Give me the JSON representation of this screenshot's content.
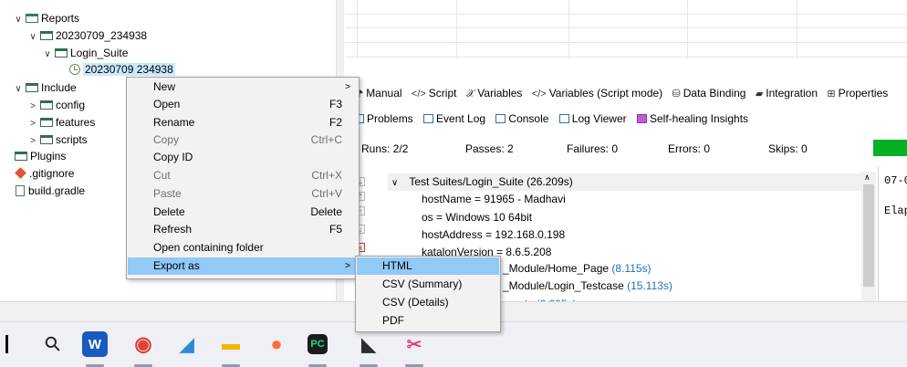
{
  "explorer": {
    "items": [
      {
        "label": "Reports",
        "toggle": "∨"
      },
      {
        "label": "20230709_234938",
        "toggle": "∨"
      },
      {
        "label": "Login_Suite",
        "toggle": "∨"
      },
      {
        "label": "20230709 234938",
        "toggle": ""
      },
      {
        "label": "Include",
        "toggle": "∨"
      },
      {
        "label": "config",
        "toggle": ">"
      },
      {
        "label": "features",
        "toggle": ">"
      },
      {
        "label": "scripts",
        "toggle": ">"
      },
      {
        "label": "Plugins",
        "toggle": ""
      },
      {
        "label": ".gitignore",
        "toggle": ""
      },
      {
        "label": "build.gradle",
        "toggle": ""
      }
    ]
  },
  "editor_tabs": [
    {
      "label": "Manual",
      "icon": "manual-icon",
      "glyph": "🖈"
    },
    {
      "label": "Script",
      "icon": "code-icon",
      "glyph": "</>"
    },
    {
      "label": "Variables",
      "icon": "variable-icon",
      "glyph": "𝒳"
    },
    {
      "label": "Variables (Script mode)",
      "icon": "code-icon",
      "glyph": "</>"
    },
    {
      "label": "Data Binding",
      "icon": "database-icon",
      "glyph": "⛁"
    },
    {
      "label": "Integration",
      "icon": "integration-icon",
      "glyph": "▰"
    },
    {
      "label": "Properties",
      "icon": "table-icon",
      "glyph": "⊞"
    }
  ],
  "views": [
    {
      "label": "Problems",
      "icon": "problems-icon"
    },
    {
      "label": "Event Log",
      "icon": "event-log-icon"
    },
    {
      "label": "Console",
      "icon": "console-icon"
    },
    {
      "label": "Log Viewer",
      "icon": "log-viewer-icon"
    },
    {
      "label": "Self-healing Insights",
      "icon": "self-healing-icon"
    }
  ],
  "stats": {
    "runs": "Runs: 2/2",
    "passes": "Passes: 2",
    "failures": "Failures: 0",
    "errors": "Errors: 0",
    "skips": "Skips: 0",
    "progress": 1.0,
    "progress_color": "#06b025"
  },
  "log": {
    "root": {
      "label": "Test Suites/Login_Suite (26.209s)",
      "toggle": "∨"
    },
    "props": [
      "hostName = 91965 - Madhavi",
      "os = Windows 10 64bit",
      "hostAddress = 192.168.0.198",
      "katalonVersion = 8.6.5.208"
    ],
    "cases": [
      {
        "name": "_Module/Home_Page",
        "time": "(8.115s)"
      },
      {
        "name": "_Module/Login_Testcase",
        "time": "(15.113s)"
      },
      {
        "name": "eports",
        "time": "(2.395s)"
      }
    ],
    "raw_lines": [
      "07-0",
      "Elap"
    ]
  },
  "context_menu": {
    "items": [
      {
        "label": "New",
        "accel": "",
        "submenu": true,
        "disabled": false
      },
      {
        "label": "Open",
        "accel": "F3",
        "submenu": false,
        "disabled": false
      },
      {
        "label": "Rename",
        "accel": "F2",
        "submenu": false,
        "disabled": false
      },
      {
        "label": "Copy",
        "accel": "Ctrl+C",
        "submenu": false,
        "disabled": true
      },
      {
        "label": "Copy ID",
        "accel": "",
        "submenu": false,
        "disabled": false
      },
      {
        "label": "Cut",
        "accel": "Ctrl+X",
        "submenu": false,
        "disabled": true
      },
      {
        "label": "Paste",
        "accel": "Ctrl+V",
        "submenu": false,
        "disabled": true
      },
      {
        "label": "Delete",
        "accel": "Delete",
        "submenu": false,
        "disabled": false
      },
      {
        "label": "Refresh",
        "accel": "F5",
        "submenu": false,
        "disabled": false
      },
      {
        "label": "Open containing folder",
        "accel": "",
        "submenu": false,
        "disabled": false
      },
      {
        "label": "Export as",
        "accel": "",
        "submenu": true,
        "disabled": false,
        "highlighted": true
      }
    ],
    "arrow": ">"
  },
  "export_submenu": {
    "items": [
      "HTML",
      "CSV (Summary)",
      "CSV (Details)",
      "PDF"
    ]
  },
  "taskbar": {
    "search_glyph": "⚲",
    "apps": [
      {
        "name": "word-icon",
        "glyph": "W",
        "color": "#185abd",
        "fg": "#ffffff"
      },
      {
        "name": "chrome-icon",
        "glyph": "◉",
        "color": "#ffffff",
        "fg": "#db4437"
      },
      {
        "name": "windows-store-icon",
        "glyph": "◢",
        "color": "#ffffff",
        "fg": "#2b8bd6"
      },
      {
        "name": "file-explorer-icon",
        "glyph": "▬",
        "color": "#ffffff",
        "fg": "#f2b600"
      },
      {
        "name": "firefox-icon",
        "glyph": "●",
        "color": "#ffffff",
        "fg": "#ff7139"
      },
      {
        "name": "pycharm-icon",
        "glyph": "PC",
        "color": "#1c1c1c",
        "fg": "#21d789"
      },
      {
        "name": "katalon-icon",
        "glyph": "◣",
        "color": "#ffffff",
        "fg": "#2d2d2d"
      },
      {
        "name": "snipping-tool-icon",
        "glyph": "✂",
        "color": "#ffffff",
        "fg": "#e0457b"
      }
    ]
  }
}
